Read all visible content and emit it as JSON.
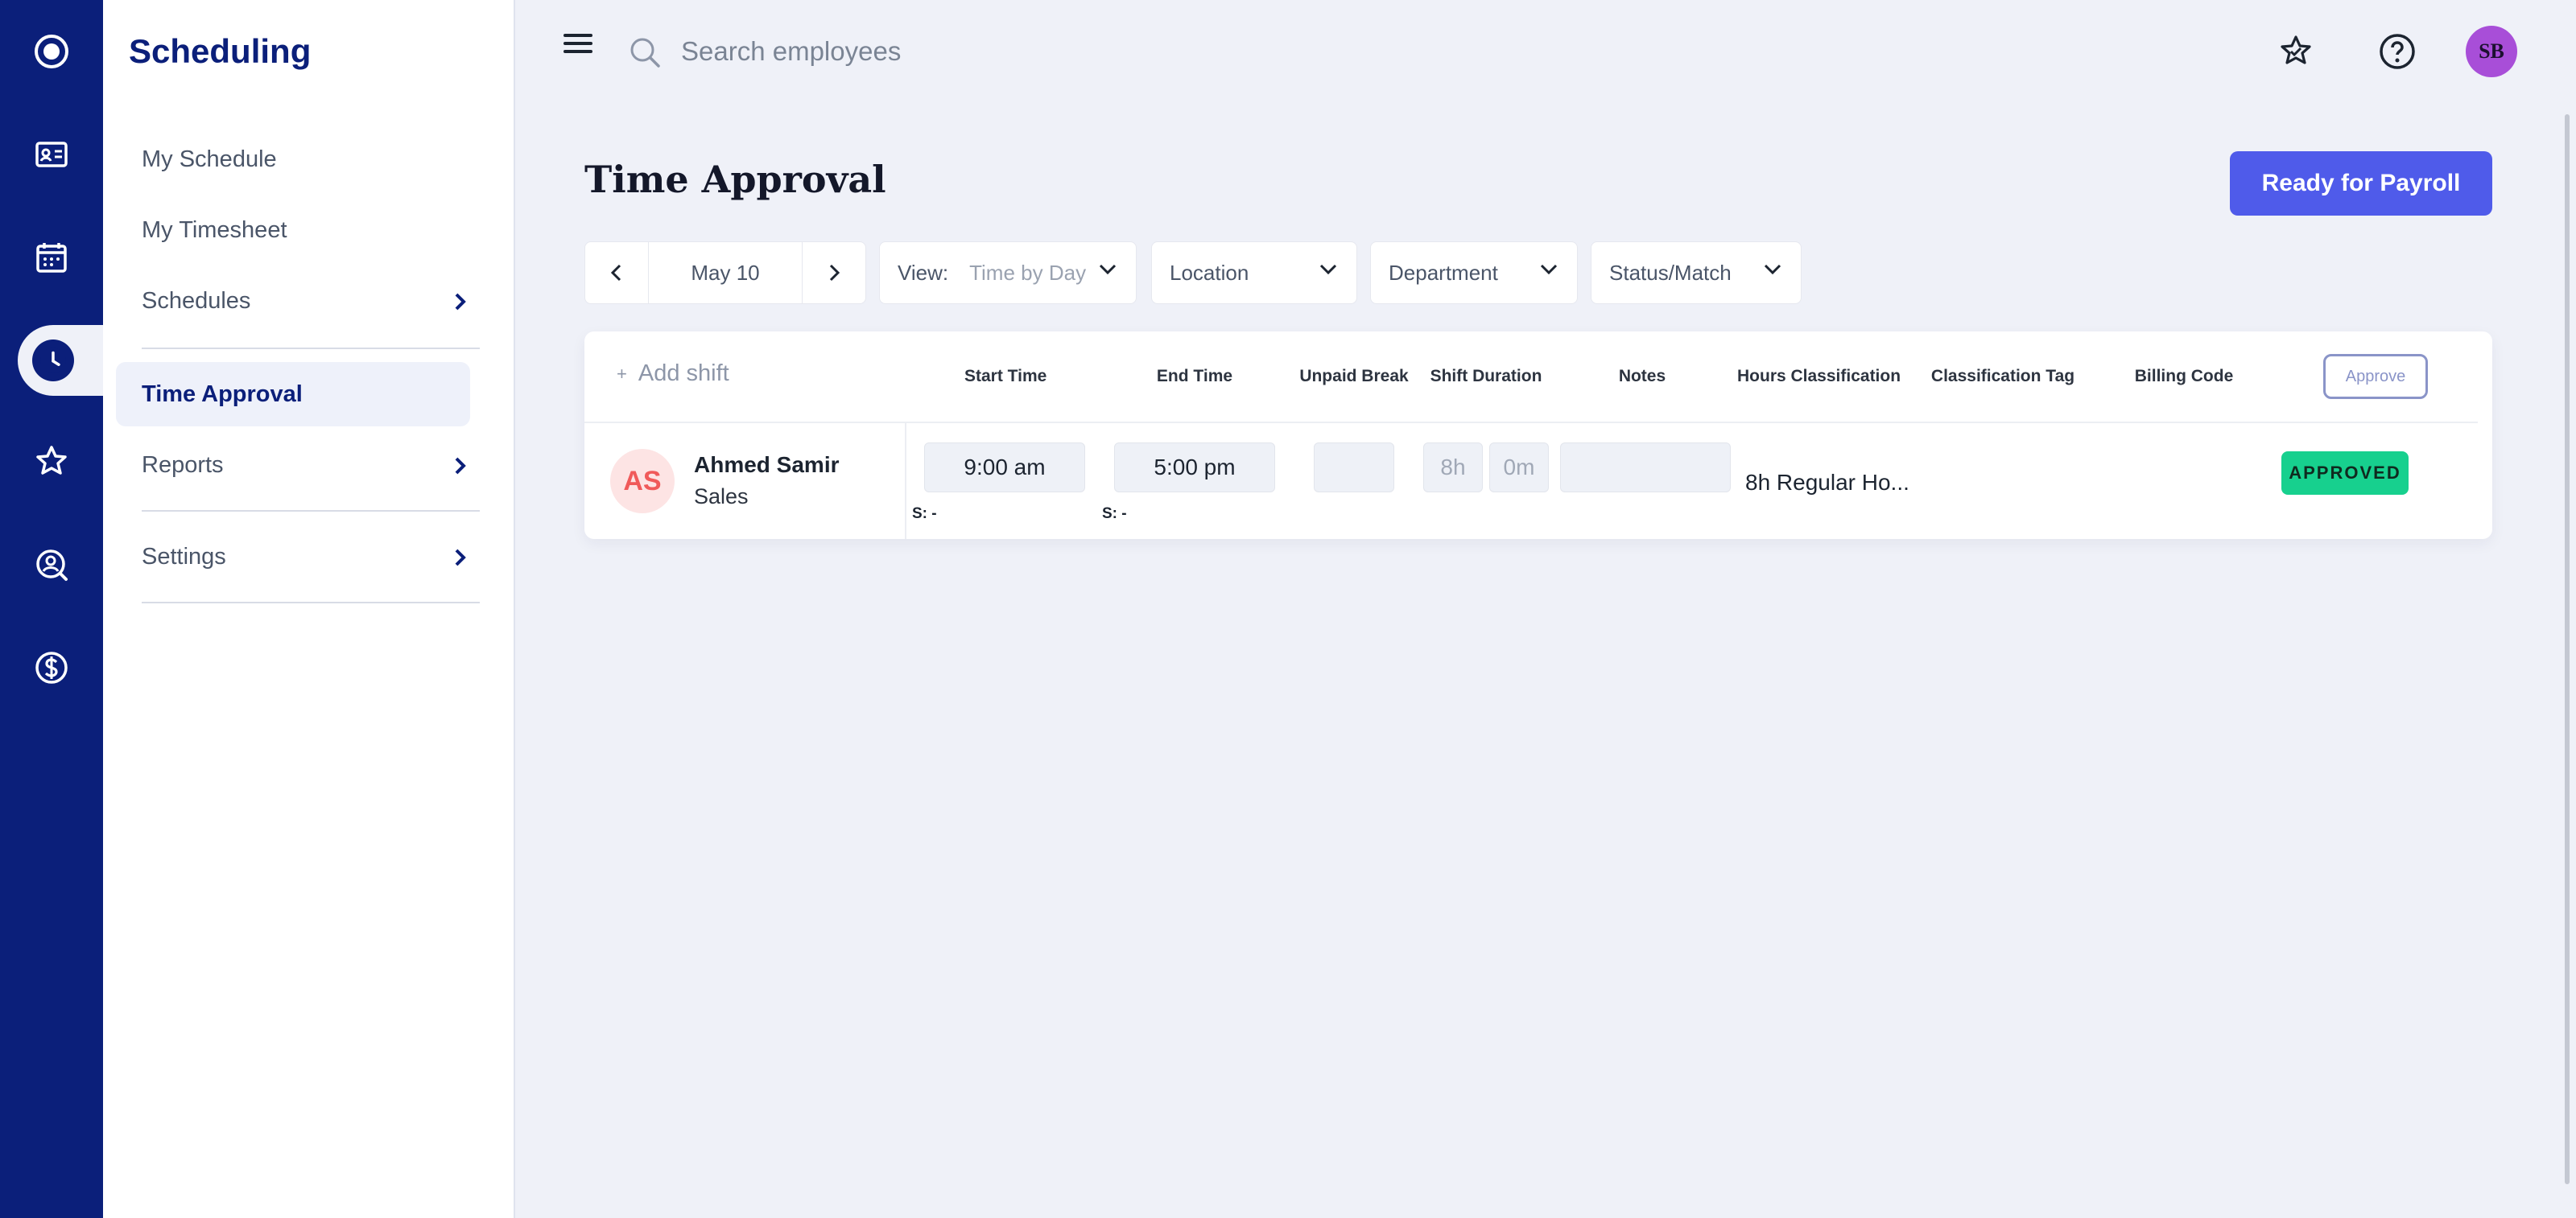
{
  "sidebar": {
    "title": "Scheduling",
    "items": [
      {
        "label": "My Schedule"
      },
      {
        "label": "My Timesheet"
      },
      {
        "label": "Schedules"
      },
      {
        "label": "Time Approval"
      },
      {
        "label": "Reports"
      },
      {
        "label": "Settings"
      }
    ]
  },
  "topbar": {
    "search_placeholder": "Search employees",
    "user_initials": "SB"
  },
  "page": {
    "title": "Time Approval",
    "payroll_button": "Ready for Payroll"
  },
  "filters": {
    "date": "May 10",
    "view_label": "View:",
    "view_value": "Time by Day",
    "location": "Location",
    "department": "Department",
    "status": "Status/Match"
  },
  "table": {
    "add_shift": "Add shift",
    "columns": [
      "Start Time",
      "End Time",
      "Unpaid Break",
      "Shift Duration",
      "Notes",
      "Hours Classification",
      "Classification Tag",
      "Billing Code"
    ],
    "approve_button": "Approve",
    "row": {
      "initials": "AS",
      "name": "Ahmed Samir",
      "department": "Sales",
      "start_time": "9:00 am",
      "end_time": "5:00 pm",
      "duration_h": "8h",
      "duration_m": "0m",
      "s_label": "S: -",
      "hours_classification": "8h Regular Ho...",
      "status": "APPROVED"
    }
  },
  "colors": {
    "rail": "#0b1f7a",
    "accent": "#4f5bea",
    "approved": "#17d08e",
    "avatar": "#a84ed8"
  }
}
